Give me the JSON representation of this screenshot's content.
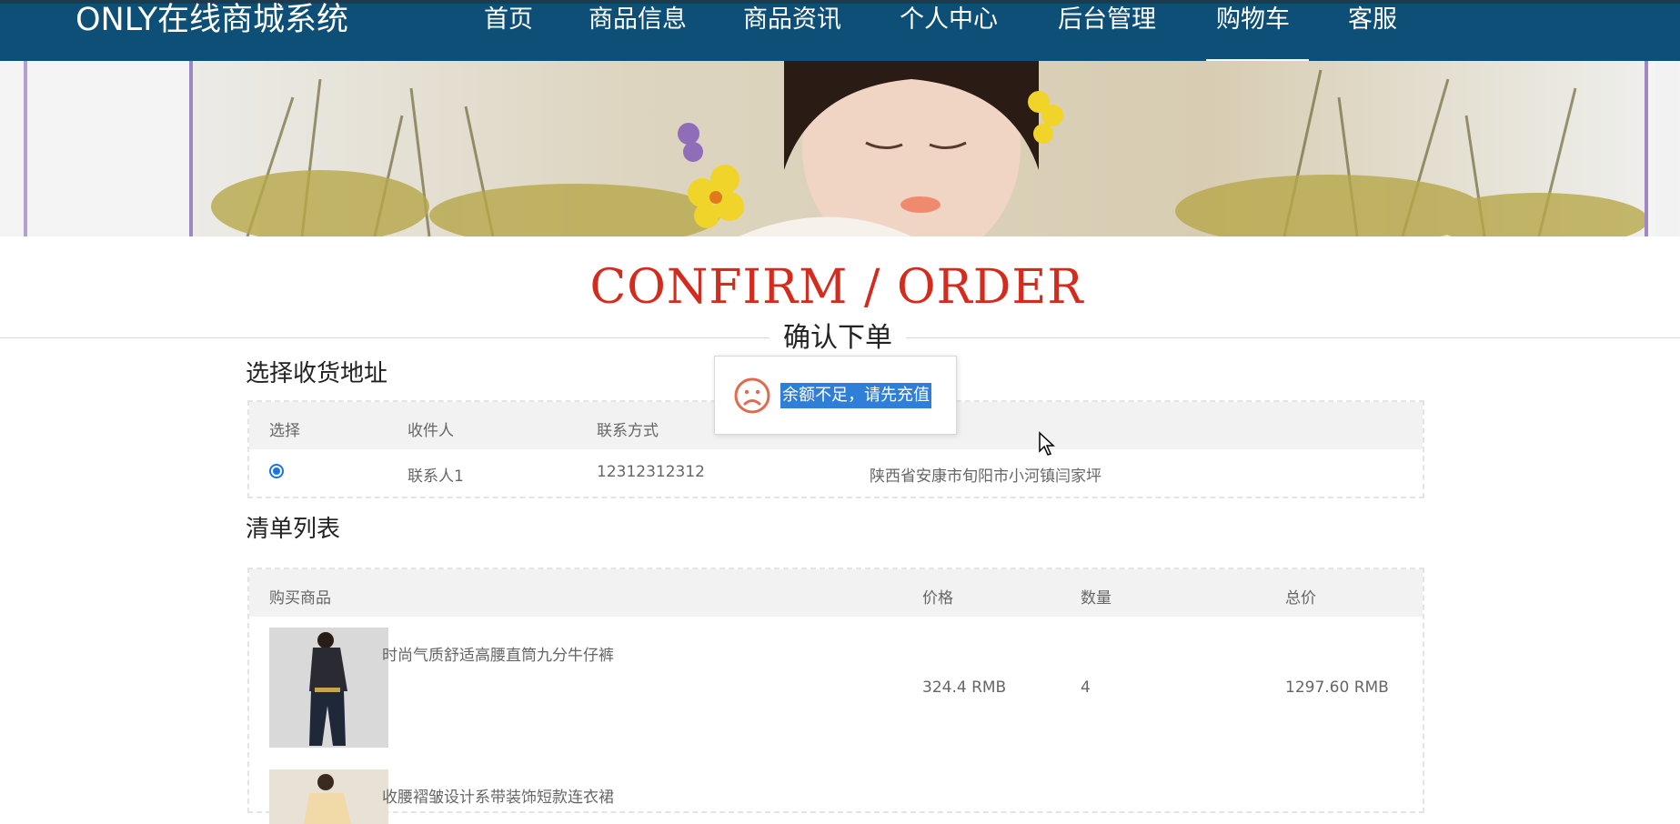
{
  "header": {
    "brand": "ONLY在线商城系统",
    "nav": [
      "首页",
      "商品信息",
      "商品资讯",
      "个人中心",
      "后台管理",
      "购物车",
      "客服"
    ],
    "active_nav": "购物车"
  },
  "page": {
    "title_en": "CONFIRM / ORDER",
    "title_cn": "确认下单"
  },
  "address_section": {
    "title": "选择收货地址",
    "headers": [
      "选择",
      "收件人",
      "联系方式",
      ""
    ],
    "rows": [
      {
        "selected": true,
        "name": "联系人1",
        "phone": "12312312312",
        "address": "陕西省安康市旬阳市小河镇闫家坪"
      }
    ]
  },
  "order_section": {
    "title": "清单列表",
    "headers": [
      "购买商品",
      "价格",
      "数量",
      "总价"
    ],
    "items": [
      {
        "name": "时尚气质舒适高腰直筒九分牛仔裤",
        "price": "324.4 RMB",
        "qty": "4",
        "total": "1297.60 RMB"
      },
      {
        "name": "收腰褶皱设计系带装饰短款连衣裙",
        "price": "",
        "qty": "",
        "total": ""
      }
    ]
  },
  "toast": {
    "message": "余额不足，请先充值",
    "icon": "sad-face-icon"
  },
  "colors": {
    "navbar": "#0e4f78",
    "title_red": "#d32b1e",
    "selection_blue": "#2f7fd9",
    "radio_blue": "#1a73e8"
  }
}
